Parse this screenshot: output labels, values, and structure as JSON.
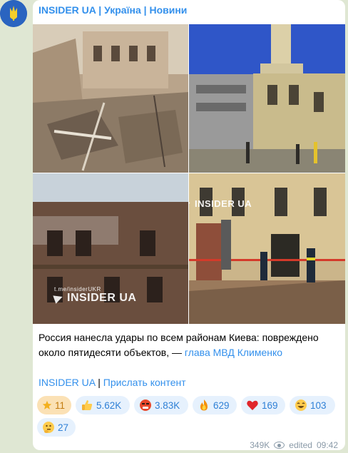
{
  "channel": {
    "title": "INSIDER UA | Україна | Новини"
  },
  "watermarks": {
    "brand": "INSIDER UA",
    "handle": "t.me/insiderUKR"
  },
  "post": {
    "text": "Россия нанесла удары по всем районам Киева: повреждено около пятидесяти объектов, — ",
    "text_link": "глава МВД Клименко",
    "footer_link_1": "INSIDER UA",
    "footer_separator": "|",
    "footer_link_2": "Прислать контент"
  },
  "reactions": [
    {
      "icon": "star-icon",
      "count": "11",
      "active": true
    },
    {
      "icon": "thumbs-up-icon",
      "count": "5.62K"
    },
    {
      "icon": "angry-face-icon",
      "count": "3.83K"
    },
    {
      "icon": "fire-icon",
      "count": "629"
    },
    {
      "icon": "red-heart-icon",
      "count": "169"
    },
    {
      "icon": "grinning-face-icon",
      "count": "103"
    },
    {
      "icon": "thinking-face-icon",
      "count": "27"
    }
  ],
  "meta": {
    "views": "349K",
    "edited_label": "edited",
    "time": "09:42"
  },
  "colors": {
    "accent": "#3390ec",
    "reaction_bg": "#e6f1fd",
    "reaction_active_bg": "#fbe1b5",
    "chat_bg": "#dfe7d3"
  }
}
